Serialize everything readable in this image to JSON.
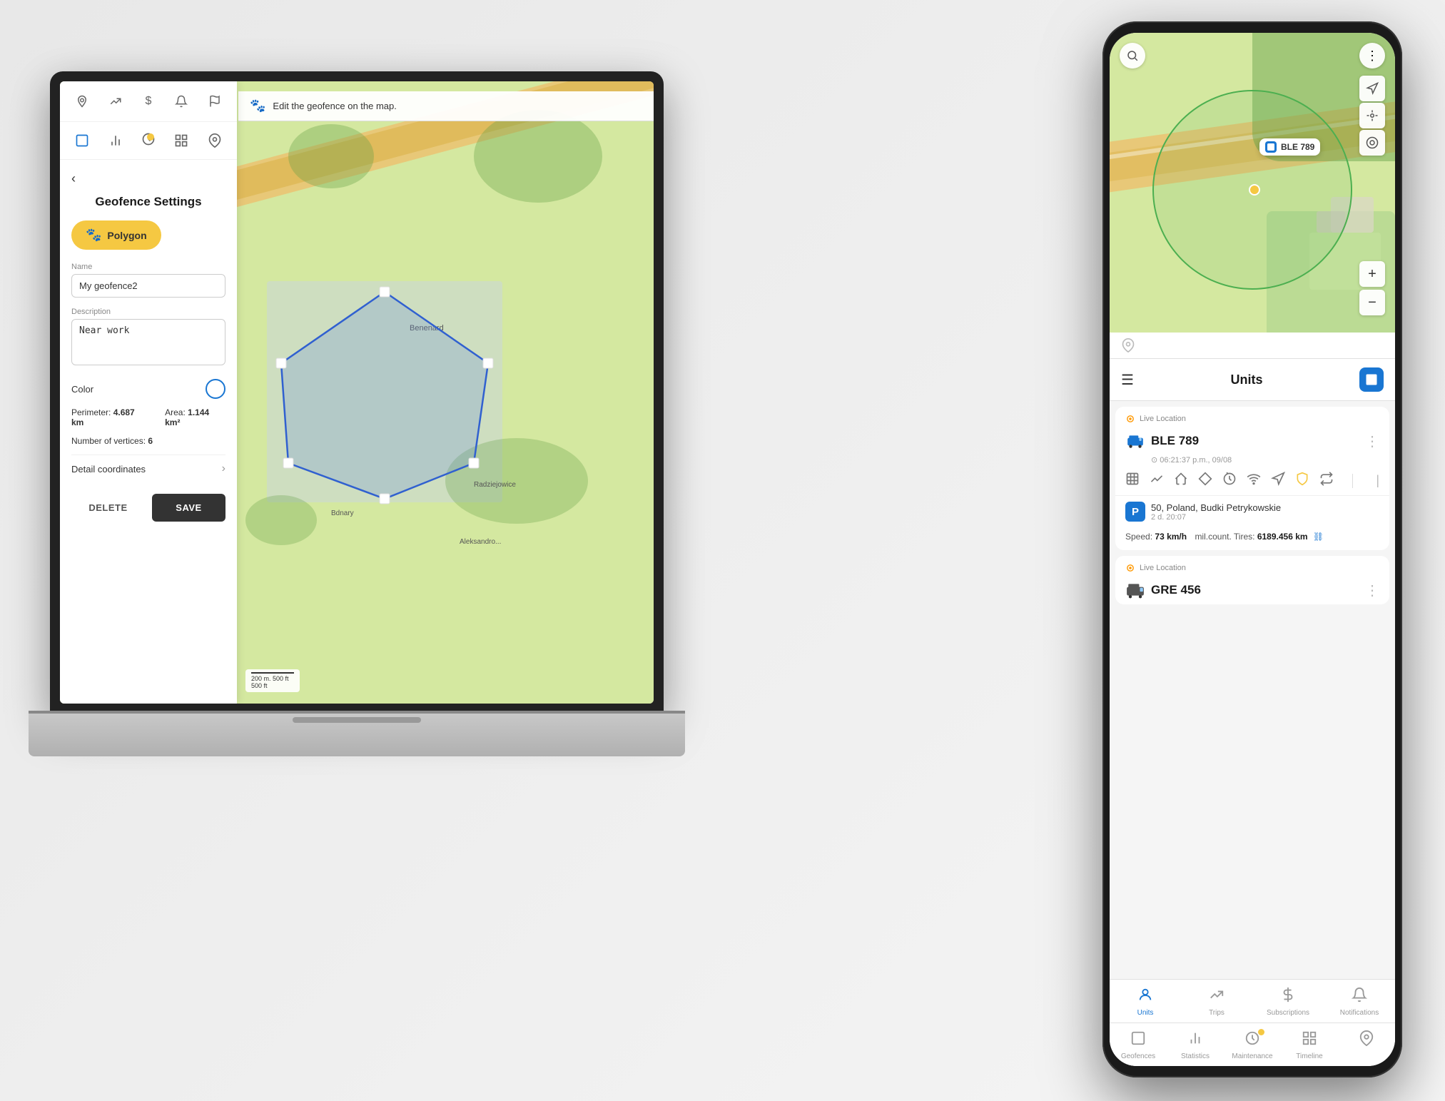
{
  "laptop": {
    "title": "Geofence Settings",
    "edit_banner": "Edit the geofence on the map.",
    "back_label": "‹",
    "polygon_label": "Polygon",
    "form": {
      "name_label": "Name",
      "name_value": "My geofence2",
      "description_label": "Description",
      "description_value": "Near work",
      "color_label": "Color"
    },
    "stats": {
      "perimeter_label": "Perimeter:",
      "perimeter_value": "4.687 km",
      "area_label": "Area:",
      "area_value": "1.144 km²"
    },
    "vertices_label": "Number of vertices:",
    "vertices_value": "6",
    "detail_coords_label": "Detail coordinates",
    "delete_label": "DELETE",
    "save_label": "SAVE",
    "scale": "200 m.\n500 ft",
    "map_label": "Benenard"
  },
  "phone": {
    "header": {
      "title": "Units",
      "menu_icon": "☰",
      "three_dots": "⋮"
    },
    "unit1": {
      "live_label": "Live Location",
      "name": "BLE 789",
      "time": "⊙ 06:21:37 p.m., 09/08",
      "location": "50, Poland, Budki Petrykowskie",
      "location_time": "2 d. 20:07",
      "speed_label": "Speed:",
      "speed_value": "73 km/h",
      "mil_label": "mil.count. Tires:",
      "mil_value": "6189.456 km",
      "map_label_text": "BLE 789"
    },
    "unit2": {
      "live_label": "Live Location",
      "name": "GRE 456"
    },
    "nav": {
      "units_label": "Units",
      "trips_label": "Trips",
      "subscriptions_label": "Subscriptions",
      "notifications_label": "Notifications",
      "geofences_label": "Geofences",
      "statistics_label": "Statistics",
      "maintenance_label": "Maintenance",
      "timeline_label": "Timeline"
    }
  },
  "icons": {
    "search": "🔍",
    "menu": "☰",
    "location_pin": "📍",
    "polygon": "⬡",
    "route": "🗺",
    "dollar": "$",
    "bell": "🔔",
    "flag": "📌",
    "chart": "📊",
    "history": "🕐",
    "grid": "⊞",
    "car": "🚗",
    "truck": "🚚",
    "parking": "P",
    "plus": "+",
    "minus": "−",
    "navigate": "➤",
    "crosshair": "◎",
    "target": "⊙",
    "chevron_down": "›",
    "dots_vertical": "⋮",
    "link": "🔗"
  },
  "colors": {
    "accent_blue": "#1976d2",
    "yellow": "#f5c842",
    "geofence_green": "#4CAF50",
    "geofence_fill": "rgba(76,175,80,0.12)",
    "road_orange": "#e8c878",
    "map_green": "#d4e8a0"
  }
}
